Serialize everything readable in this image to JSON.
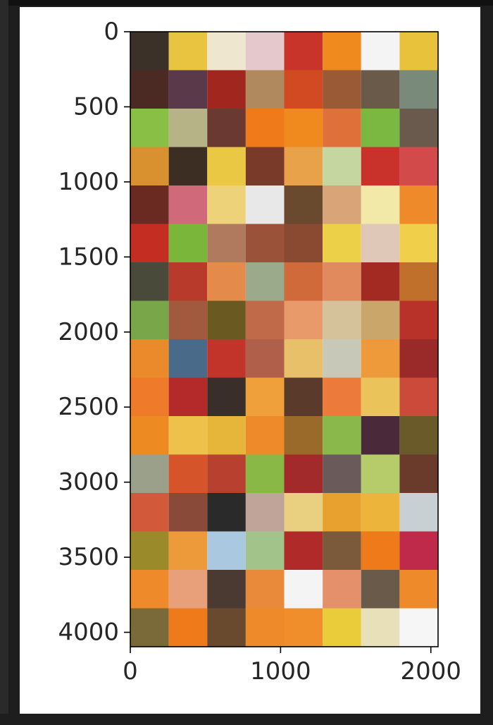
{
  "chart_data": {
    "type": "image",
    "title": "",
    "xlabel": "",
    "ylabel": "",
    "image_extent": {
      "x": [
        0,
        2048
      ],
      "y": [
        0,
        4096
      ]
    },
    "xlim": [
      0,
      2048
    ],
    "ylim": [
      4096,
      0
    ],
    "grid": false,
    "x_ticks": [
      {
        "value": 0,
        "label": "0"
      },
      {
        "value": 1000,
        "label": "1000"
      },
      {
        "value": 2000,
        "label": "2000"
      }
    ],
    "y_ticks": [
      {
        "value": 0,
        "label": "0"
      },
      {
        "value": 500,
        "label": "500"
      },
      {
        "value": 1000,
        "label": "1000"
      },
      {
        "value": 1500,
        "label": "1500"
      },
      {
        "value": 2000,
        "label": "2000"
      },
      {
        "value": 2500,
        "label": "2500"
      },
      {
        "value": 3000,
        "label": "3000"
      },
      {
        "value": 3500,
        "label": "3500"
      },
      {
        "value": 4000,
        "label": "4000"
      }
    ],
    "mosaic": {
      "columns": 8,
      "rows": 16,
      "tile_size": 256,
      "tiles": [
        [
          "#3b3128",
          "#e8c440",
          "#efe6cf",
          "#e4c8cc",
          "#c8342a",
          "#ee8a1e",
          "#f4f4f4",
          "#e7c23a"
        ],
        [
          "#4a2a22",
          "#5a3a4a",
          "#a0261e",
          "#b08a5e",
          "#d24a22",
          "#9a5a36",
          "#6a5a4a",
          "#7a8a7a"
        ],
        [
          "#8abf46",
          "#b6b486",
          "#6a3a32",
          "#ee7a1a",
          "#f08a1e",
          "#e0703a",
          "#7ab842",
          "#6a5a4e"
        ],
        [
          "#d9902e",
          "#3c2e22",
          "#eac844",
          "#7a3a2a",
          "#e8a24a",
          "#c6d6a0",
          "#c8322a",
          "#d24a4a"
        ],
        [
          "#6a2a22",
          "#d06a7a",
          "#eed27a",
          "#e8e8e8",
          "#6a4a2e",
          "#d8a478",
          "#f2e8a8",
          "#ee8a2a"
        ],
        [
          "#c42e22",
          "#7ab63a",
          "#b07a5e",
          "#9a5238",
          "#8a4a32",
          "#ecd048",
          "#e0c8b8",
          "#f0d04a"
        ],
        [
          "#4a4a3a",
          "#b83a2a",
          "#e48a4a",
          "#9aaa8a",
          "#d06a3a",
          "#e08a5e",
          "#a22a22",
          "#c0702a"
        ],
        [
          "#7aa64a",
          "#a25a3e",
          "#6a5a22",
          "#c06a4a",
          "#e89a6a",
          "#d6c29a",
          "#caa66a",
          "#b8322a"
        ],
        [
          "#ea8a2a",
          "#4a6a8a",
          "#c2342a",
          "#b0604a",
          "#e8c06a",
          "#c8c8b8",
          "#ef9a3a",
          "#9a2a2a"
        ],
        [
          "#ee7a2a",
          "#b42a2a",
          "#3a2e2a",
          "#f0a03a",
          "#5a3a2a",
          "#ec7a3a",
          "#eac45a",
          "#cc4a3a"
        ],
        [
          "#ee8a22",
          "#eec24a",
          "#e6b63a",
          "#ee8a2a",
          "#9a6a2a",
          "#8ab84a",
          "#4a2a3a",
          "#6a5a2a"
        ],
        [
          "#9aa08a",
          "#d6542a",
          "#b8402e",
          "#8ab846",
          "#a22a2a",
          "#6a5a5a",
          "#b6cc6a",
          "#6a3a2a"
        ],
        [
          "#d25a3a",
          "#8a4a3a",
          "#2a2a2a",
          "#c0a49a",
          "#e8d080",
          "#e8a02e",
          "#ecb43a",
          "#c8d0d4"
        ],
        [
          "#9a8a2a",
          "#ec9a3a",
          "#aac8e0",
          "#a2c48a",
          "#b02a2a",
          "#7a5a3a",
          "#ee7a1a",
          "#c02a4a"
        ],
        [
          "#ee8a2a",
          "#e8a07a",
          "#4a3a32",
          "#e88a3a",
          "#f4f4f4",
          "#e4906a",
          "#6a5a4a",
          "#ee8a2a"
        ],
        [
          "#7a6a3a",
          "#ee7a1a",
          "#6a4a2e",
          "#ee8a2a",
          "#ef8e2a",
          "#eacb3a",
          "#e8e0b8",
          "#f6f6f6"
        ]
      ]
    }
  }
}
